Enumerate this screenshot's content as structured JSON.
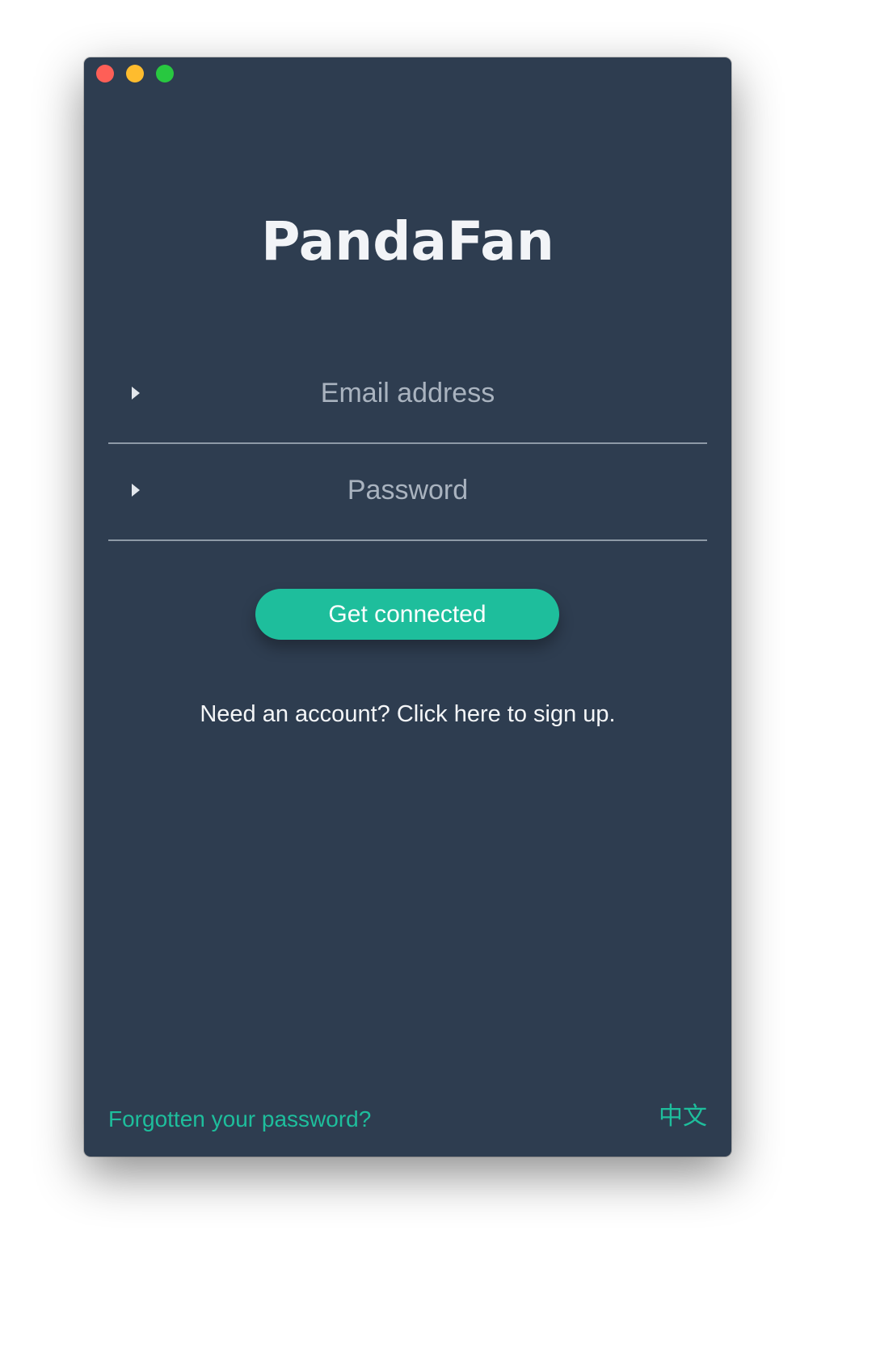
{
  "window": {
    "title_bar": {
      "lights": [
        {
          "name": "close",
          "color": "#fe5f57"
        },
        {
          "name": "minimize",
          "color": "#febc2e"
        },
        {
          "name": "zoom",
          "color": "#28c840"
        }
      ]
    },
    "background_color": "#2e3d50"
  },
  "app": {
    "title": "PandaFan"
  },
  "form": {
    "email": {
      "placeholder": "Email address",
      "value": ""
    },
    "password": {
      "placeholder": "Password",
      "value": ""
    },
    "submit_label": "Get connected",
    "accent_color": "#1ebe9c"
  },
  "links": {
    "signup": "Need an account? Click here to sign up.",
    "forgot_password": "Forgotten your password?",
    "language": "中文"
  }
}
